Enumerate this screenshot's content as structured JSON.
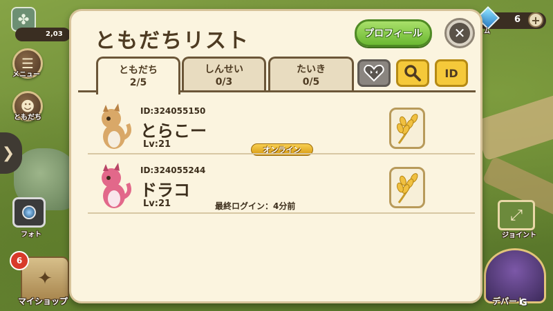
{
  "background": {
    "left_hud": {
      "top_counter": "2,03",
      "menu_label": "メニュー",
      "friends_label": "ともだち",
      "photo_label": "フォト",
      "shop_label": "マイショップ",
      "shop_badge": "6"
    },
    "right_hud": {
      "gem_label": "ム",
      "gem_count": "6",
      "plus_label": "+",
      "joint_label": "ジョイント",
      "depart_label": "デパート",
      "watermark": "G"
    }
  },
  "dialog": {
    "title": "ともだちリスト",
    "profile_button": "プロフィール",
    "close_button": "✕",
    "tabs": [
      {
        "label": "ともだち",
        "count": "2/5",
        "active": true
      },
      {
        "label": "しんせい",
        "count": "0/3",
        "active": false
      },
      {
        "label": "たいき",
        "count": "0/5",
        "active": false
      }
    ],
    "id_button": "ID",
    "friends": [
      {
        "id": "ID:324055150",
        "name": "とらこー",
        "level": "Lv:21",
        "status": "オンライン",
        "avatar_color": "#d9a868"
      },
      {
        "id": "ID:324055244",
        "name": "ドラコ",
        "level": "Lv:21",
        "status": "最終ログイン：4分前",
        "avatar_color": "#e2688a"
      }
    ]
  },
  "colors": {
    "dialog_bg": "#fbf4df",
    "dialog_border": "#d7c39a",
    "profile_green": "#6bb832",
    "id_yellow": "#f5c93a",
    "text_brown": "#4e3b22"
  }
}
